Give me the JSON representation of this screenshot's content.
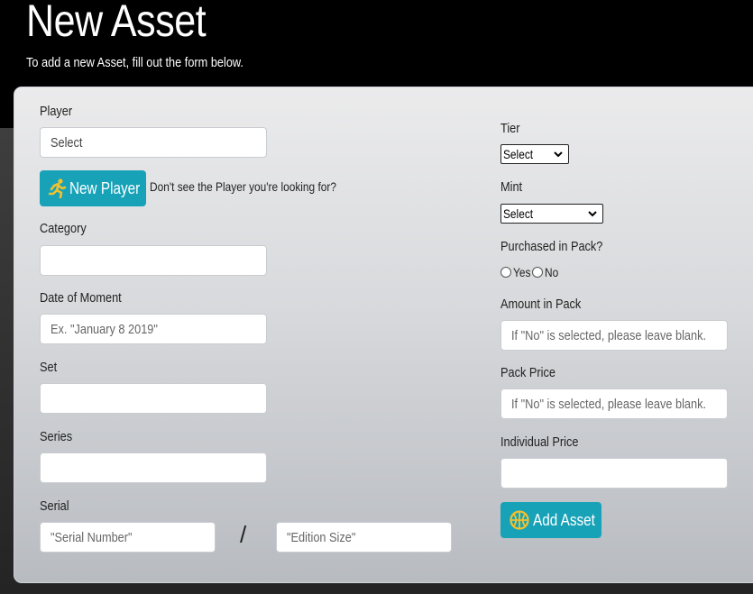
{
  "page": {
    "title": "New Asset",
    "subtitle": "To add a new Asset, fill out the form below."
  },
  "left": {
    "player_label": "Player",
    "player_select": "Select",
    "new_player_button": "New Player",
    "new_player_hint": "Don't see the Player you're looking for?",
    "category_label": "Category",
    "category_value": "",
    "date_label": "Date of Moment",
    "date_placeholder": "Ex. \"January 8 2019\"",
    "set_label": "Set",
    "set_value": "",
    "series_label": "Series",
    "series_value": "",
    "serial_label": "Serial",
    "serial_placeholder": "\"Serial Number\"",
    "serial_separator": "/",
    "edition_placeholder": "\"Edition Size\""
  },
  "right": {
    "tier_label": "Tier",
    "tier_select": "Select",
    "mint_label": "Mint",
    "mint_select": "Select",
    "pack_label": "Purchased in Pack?",
    "pack_options": [
      "Yes",
      "No"
    ],
    "amount_label": "Amount in Pack",
    "amount_placeholder": "If \"No\" is selected, please leave blank.",
    "pack_price_label": "Pack Price",
    "pack_price_placeholder": "If \"No\" is selected, please leave blank.",
    "individual_price_label": "Individual Price",
    "individual_price_value": "",
    "add_asset_button": "Add Asset"
  },
  "icons": {
    "new_player": "running-person-icon",
    "add_asset": "basketball-icon",
    "select_chevron": "chevron-down-icon"
  },
  "colors": {
    "button": "#17a2b8",
    "icon_yellow": "#f2c12e",
    "header_bg": "#000000"
  }
}
